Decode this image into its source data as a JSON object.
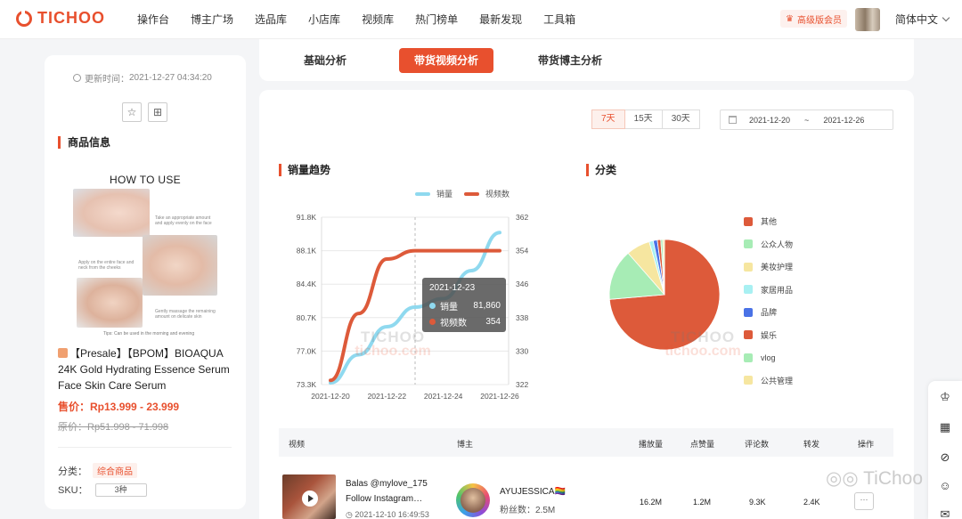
{
  "header": {
    "logo": "TICHOO",
    "nav": [
      "操作台",
      "博主广场",
      "选品库",
      "小店库",
      "视频库",
      "热门榜单",
      "最新发现",
      "工具箱"
    ],
    "vip_label": "高级版会员",
    "language": "简体中文"
  },
  "product": {
    "update_label": "更新时间：",
    "update_time": "2021-12-27 04:34:20",
    "section_title": "商品信息",
    "image": {
      "title": "HOW TO USE",
      "steps": [
        "Take an appropriate amount and apply evenly on the face",
        "Apply on the entire face and neck from the cheeks",
        "Gently massage the remaining amount on delicate skin"
      ],
      "tips": "Tips: Can be used in the morning and evening"
    },
    "name": "【Presale】【BPOM】BIOAQUA 24K Gold Hydrating Essence Serum Face Skin Care Serum",
    "price_label": "售价：",
    "price": "Rp13.999 - 23.999",
    "orig_label": "原价：",
    "orig_price": "Rp51.998 - 71.998",
    "category_label": "分类：",
    "category": "综合商品",
    "sku_label": "SKU：",
    "sku": "3种"
  },
  "tabs": {
    "basic": "基础分析",
    "video": "带货视频分析",
    "blogger": "带货博主分析"
  },
  "filters": {
    "ranges": [
      "7天",
      "15天",
      "30天"
    ],
    "active_range": "7天",
    "start_date": "2021-12-20",
    "separator": "~",
    "end_date": "2021-12-26"
  },
  "trend": {
    "title": "销量趋势",
    "tooltip": {
      "date": "2021-12-23",
      "sales_label": "销量",
      "sales_value": "81,860",
      "videos_label": "视频数",
      "videos_value": "354"
    }
  },
  "category_pie": {
    "title": "分类"
  },
  "chart_data": [
    {
      "type": "line",
      "title": "销量趋势",
      "x": [
        "2021-12-20",
        "2021-12-21",
        "2021-12-22",
        "2021-12-23",
        "2021-12-24",
        "2021-12-25",
        "2021-12-26"
      ],
      "x_ticks": [
        "2021-12-20",
        "2021-12-22",
        "2021-12-24",
        "2021-12-26"
      ],
      "series": [
        {
          "name": "销量",
          "axis": "left",
          "color": "#8fd9ef",
          "values": [
            73.5,
            76.6,
            79.7,
            81.86,
            82.8,
            85.9,
            90.1
          ]
        },
        {
          "name": "视频数",
          "axis": "right",
          "color": "#dd5a3a",
          "values": [
            323,
            339,
            352,
            354,
            354,
            354,
            354
          ]
        }
      ],
      "y_left": {
        "ticks": [
          "73.3K",
          "77.0K",
          "80.7K",
          "84.4K",
          "88.1K",
          "91.8K"
        ],
        "lim": [
          73.3,
          91.8
        ],
        "unit": "K"
      },
      "y_right": {
        "ticks": [
          "322",
          "330",
          "338",
          "346",
          "354",
          "362"
        ],
        "lim": [
          322,
          362
        ]
      },
      "legend": "top",
      "grid": true
    },
    {
      "type": "pie",
      "title": "分类",
      "labels": [
        "其他",
        "公众人物",
        "美妆护理",
        "家居用品",
        "品牌",
        "娱乐",
        "vlog",
        "公共管理"
      ],
      "values": [
        74,
        15,
        7,
        1.2,
        1.2,
        1,
        0.6,
        0.5
      ],
      "colors": [
        "#dd5a3a",
        "#a7ecb5",
        "#f6e6a0",
        "#a8f0f2",
        "#4a72e6",
        "#dd5a3a",
        "#a7ecb5",
        "#f6e6a0"
      ],
      "legend": "right"
    }
  ],
  "table": {
    "headers": {
      "video": "视频",
      "blogger": "博主",
      "plays": "播放量",
      "likes": "点赞量",
      "comments": "评论数",
      "shares": "转发",
      "actions": "操作"
    },
    "rows": [
      {
        "title": "Balas @mylove_175 Follow Instagram…",
        "date": "2021-12-10 16:49:53",
        "blogger": "AYUJESSICA🏳️‍🌈",
        "fans_label": "粉丝数：",
        "fans": "2.5M",
        "plays": "16.2M",
        "likes": "1.2M",
        "comments": "9.3K",
        "shares": "2.4K",
        "more": "···"
      }
    ]
  },
  "watermarks": {
    "brand": "TICHOO",
    "site": "tichoo.com",
    "wechat": "TiChoo"
  }
}
